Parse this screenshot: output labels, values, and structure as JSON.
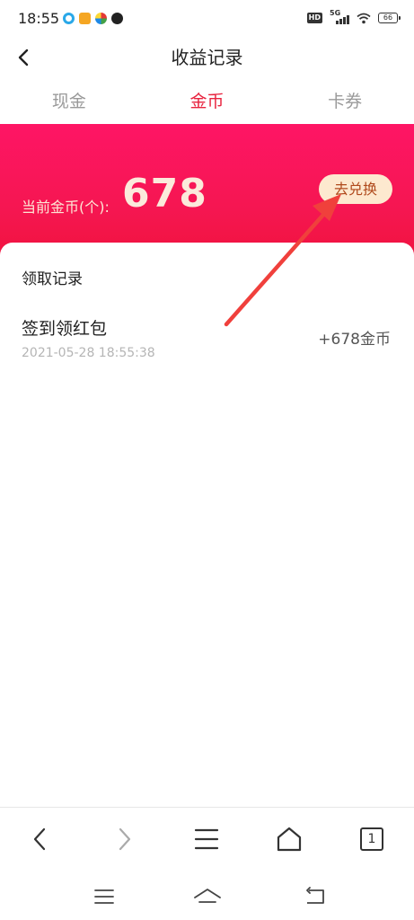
{
  "status_bar": {
    "time": "18:55",
    "hd_label": "HD",
    "network_label": "5G",
    "battery": "66"
  },
  "header": {
    "title": "收益记录",
    "back_icon": "chevron-left-icon"
  },
  "tabs": [
    {
      "label": "现金",
      "active": false
    },
    {
      "label": "金币",
      "active": true
    },
    {
      "label": "卡券",
      "active": false
    }
  ],
  "hero": {
    "label": "当前金币(个):",
    "value": "678",
    "exchange_label": "去兑换"
  },
  "records": {
    "section_title": "领取记录",
    "items": [
      {
        "title": "签到领红包",
        "time": "2021-05-28 18:55:38",
        "amount": "+678金币"
      }
    ]
  },
  "browser_bar": {
    "tab_count": "1",
    "icons": [
      "back-icon",
      "forward-icon",
      "menu-icon",
      "home-icon",
      "tabs-icon"
    ]
  },
  "colors": {
    "accent": "#e8243f",
    "hero_top": "#fe1565",
    "hero_bottom": "#f0133b",
    "exchange_bg": "#fde9cf",
    "arrow": "#f0403c"
  }
}
